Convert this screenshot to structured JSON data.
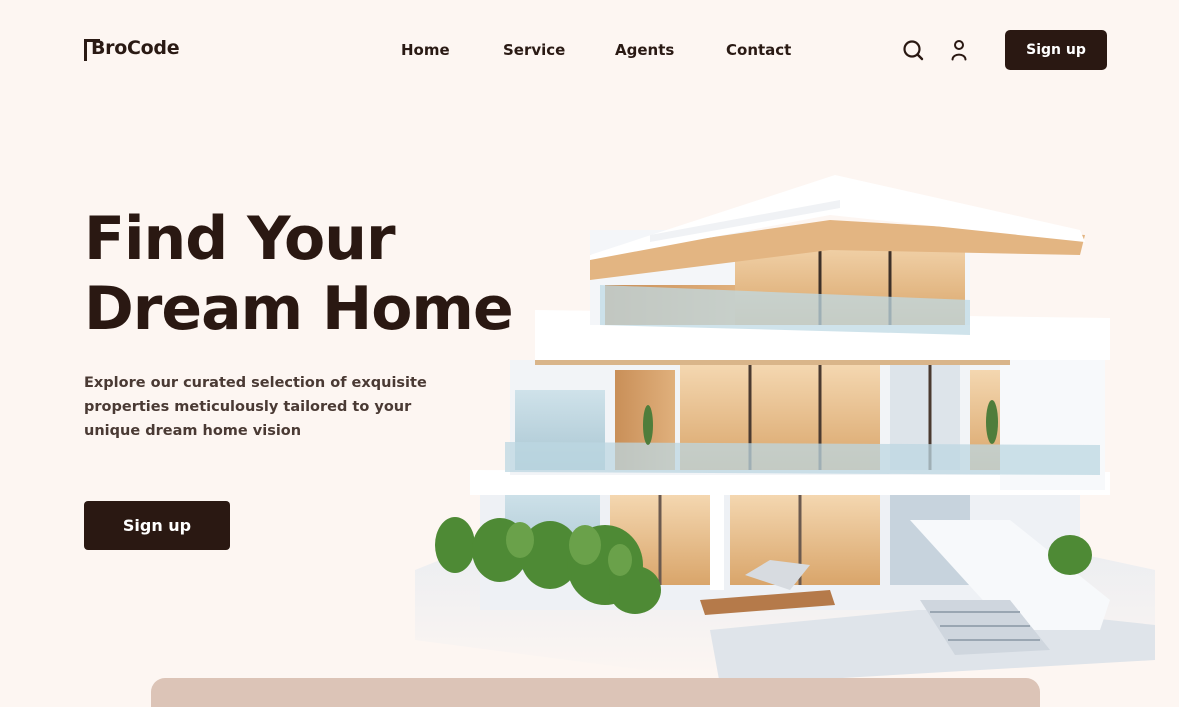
{
  "brand": {
    "name": "BroCode"
  },
  "nav": {
    "links": [
      {
        "label": "Home"
      },
      {
        "label": "Service"
      },
      {
        "label": "Agents"
      },
      {
        "label": "Contact"
      }
    ],
    "icons": {
      "search": "search-icon",
      "account": "user-icon"
    },
    "signup_label": "Sign up"
  },
  "hero": {
    "title_line1": "Find Your",
    "title_line2": "Dream Home",
    "description": "Explore our curated selection of exquisite properties meticulously tailored to your unique dream home vision",
    "cta_label": "Sign up"
  },
  "colors": {
    "background": "#fdf6f2",
    "primary_dark": "#2a1812",
    "panel_tan": "#dcc4b7"
  }
}
